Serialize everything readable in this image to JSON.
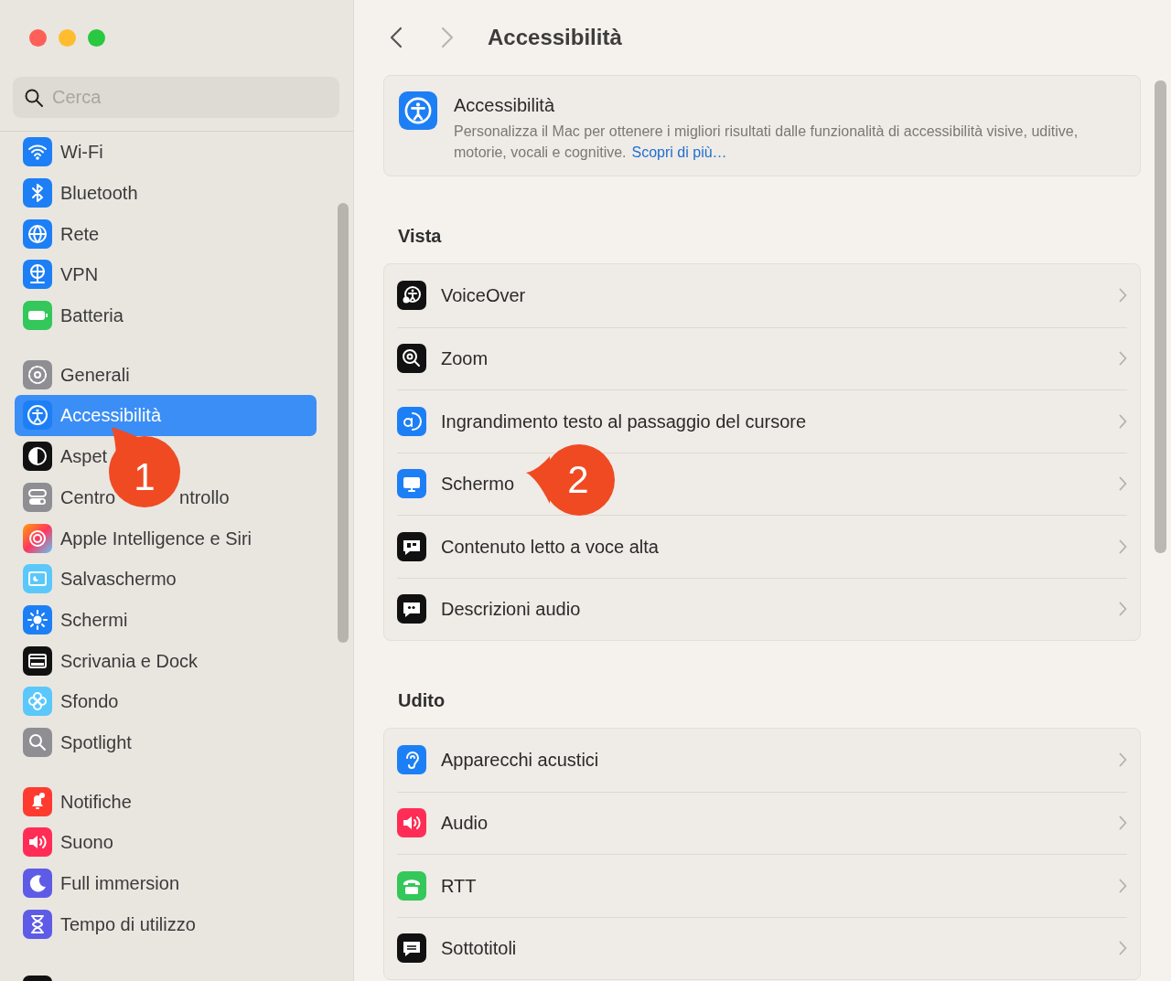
{
  "sidebar": {
    "search": {
      "placeholder": "Cerca"
    },
    "groups": [
      [
        {
          "label": "Wi-Fi",
          "selected": false
        },
        {
          "label": "Bluetooth",
          "selected": false
        },
        {
          "label": "Rete",
          "selected": false
        },
        {
          "label": "VPN",
          "selected": false
        },
        {
          "label": "Batteria",
          "selected": false
        }
      ],
      [
        {
          "label": "Generali",
          "selected": false
        },
        {
          "label": "Accessibilità",
          "selected": true
        },
        {
          "label_parts": [
            "Aspet"
          ],
          "selected": false
        },
        {
          "label_parts": [
            "Centro",
            "ntrollo"
          ],
          "selected": false
        },
        {
          "label": "Apple Intelligence e Siri",
          "selected": false
        },
        {
          "label": "Salvaschermo",
          "selected": false
        },
        {
          "label": "Schermi",
          "selected": false
        },
        {
          "label": "Scrivania e Dock",
          "selected": false
        },
        {
          "label": "Sfondo",
          "selected": false
        },
        {
          "label": "Spotlight",
          "selected": false
        }
      ],
      [
        {
          "label": "Notifiche",
          "selected": false
        },
        {
          "label": "Suono",
          "selected": false
        },
        {
          "label": "Full immersion",
          "selected": false
        },
        {
          "label": "Tempo di utilizzo",
          "selected": false
        }
      ],
      [
        {
          "kind": "clipped"
        }
      ]
    ]
  },
  "toolbar": {
    "back_disabled": false,
    "forward_disabled": true,
    "title": "Accessibilità"
  },
  "intro": {
    "title": "Accessibilità",
    "description": "Personalizza il Mac per ottenere i migliori risultati dalle funzionalità di accessibilità visive, uditive, motorie, vocali e cognitive.",
    "link": "Scopri di più…"
  },
  "sections": [
    {
      "title": "Vista",
      "rows": [
        {
          "label": "VoiceOver"
        },
        {
          "label": "Zoom"
        },
        {
          "label": "Ingrandimento testo al passaggio del cursore"
        },
        {
          "label": "Schermo"
        },
        {
          "label": "Contenuto letto a voce alta"
        },
        {
          "label": "Descrizioni audio"
        }
      ]
    },
    {
      "title": "Udito",
      "rows": [
        {
          "label": "Apparecchi acustici"
        },
        {
          "label": "Audio"
        },
        {
          "label": "RTT"
        },
        {
          "label": "Sottotitoli"
        }
      ]
    }
  ],
  "callouts": [
    {
      "number": "1"
    },
    {
      "number": "2"
    }
  ]
}
